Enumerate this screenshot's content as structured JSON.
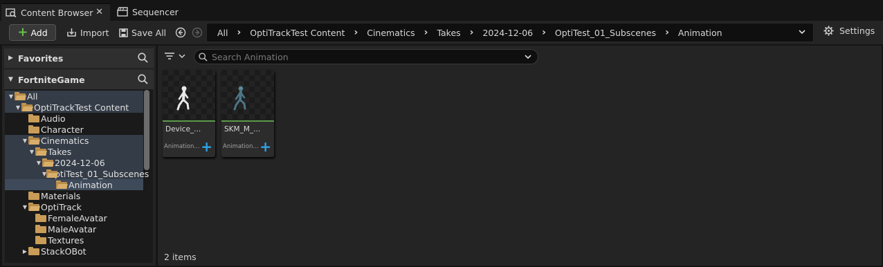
{
  "tabs": [
    {
      "label": "Content Browser",
      "icon": "content-browser-icon",
      "active": true
    },
    {
      "label": "Sequencer",
      "icon": "clapperboard-icon",
      "active": false
    }
  ],
  "toolbar": {
    "add_label": "Add",
    "import_label": "Import",
    "save_all_label": "Save All",
    "settings_label": "Settings"
  },
  "breadcrumb": [
    "All",
    "OptiTrackTest Content",
    "Cinematics",
    "Takes",
    "2024-12-06",
    "OptiTest_01_Subscenes",
    "Animation"
  ],
  "left": {
    "favorites_label": "Favorites",
    "project_label": "FortniteGame",
    "tree": [
      {
        "label": "All",
        "indent": 0,
        "expanded": true,
        "open": true,
        "state": "hl"
      },
      {
        "label": "OptiTrackTest Content",
        "indent": 1,
        "expanded": true,
        "open": true,
        "state": "hl"
      },
      {
        "label": "Audio",
        "indent": 2,
        "expanded": null,
        "open": false,
        "state": ""
      },
      {
        "label": "Character",
        "indent": 2,
        "expanded": null,
        "open": false,
        "state": ""
      },
      {
        "label": "Cinematics",
        "indent": 2,
        "expanded": true,
        "open": true,
        "state": "hl"
      },
      {
        "label": "Takes",
        "indent": 3,
        "expanded": true,
        "open": true,
        "state": "hl"
      },
      {
        "label": "2024-12-06",
        "indent": 4,
        "expanded": true,
        "open": true,
        "state": "hl"
      },
      {
        "label": "OptiTest_01_Subscenes",
        "indent": 5,
        "expanded": true,
        "open": true,
        "state": "hl"
      },
      {
        "label": "Animation",
        "indent": 6,
        "expanded": null,
        "open": true,
        "state": "sel"
      },
      {
        "label": "Materials",
        "indent": 2,
        "expanded": null,
        "open": false,
        "state": ""
      },
      {
        "label": "OptiTrack",
        "indent": 2,
        "expanded": true,
        "open": true,
        "state": ""
      },
      {
        "label": "FemaleAvatar",
        "indent": 3,
        "expanded": null,
        "open": false,
        "state": ""
      },
      {
        "label": "MaleAvatar",
        "indent": 3,
        "expanded": null,
        "open": false,
        "state": ""
      },
      {
        "label": "Textures",
        "indent": 3,
        "expanded": null,
        "open": false,
        "state": ""
      },
      {
        "label": "StackOBot",
        "indent": 2,
        "expanded": false,
        "open": false,
        "state": ""
      }
    ]
  },
  "main": {
    "search_placeholder": "Search Animation",
    "assets": [
      {
        "name": "Device_...",
        "type": "Animation...",
        "figure_color": "#e8e8e8"
      },
      {
        "name": "SKM_M_...",
        "type": "Animation...",
        "figure_color": "#5f8fa0"
      }
    ],
    "item_count": "2 items"
  }
}
